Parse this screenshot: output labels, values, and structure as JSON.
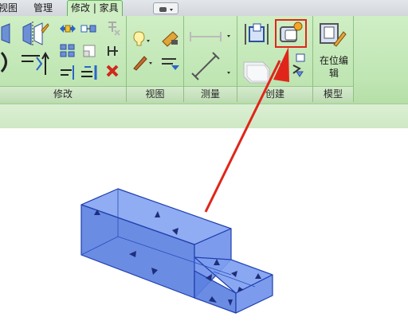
{
  "tabs": [
    {
      "label": "视图"
    },
    {
      "label": "管理"
    },
    {
      "label": "修改 | 家具"
    }
  ],
  "panels": {
    "modify": "修改",
    "view": "视图",
    "measure": "测量",
    "create": "创建",
    "model": "模型"
  },
  "buttons": {
    "edit_in_place": "在位编辑"
  },
  "colors": {
    "ribbon": "#cfeec4",
    "active_tab_border": "#5fb35a",
    "highlight_box": "#e0261a",
    "arrow": "#e0261a",
    "solid_fill": "#5b7fe0",
    "solid_edge": "#1f3fae"
  },
  "icons": [
    "align-icon",
    "mirror-icon",
    "move-icon",
    "copy-icon",
    "delete-icon",
    "visibility-icon",
    "paint-icon",
    "dimension-icon",
    "family-types-icon",
    "create-form-icon",
    "edit-in-place-icon"
  ]
}
